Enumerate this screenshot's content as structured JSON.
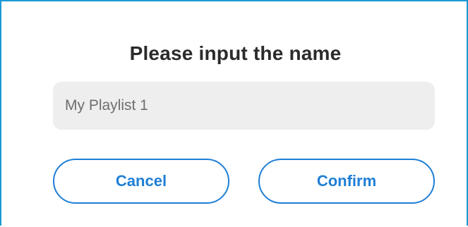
{
  "dialog": {
    "title": "Please input the name",
    "name_input": {
      "value": "My Playlist 1",
      "placeholder": ""
    },
    "cancel_label": "Cancel",
    "confirm_label": "Confirm"
  },
  "colors": {
    "accent": "#1f7fd6",
    "frame_border": "#1a98d5",
    "input_background": "#eeeeee",
    "title_text": "#2b2b2b"
  }
}
